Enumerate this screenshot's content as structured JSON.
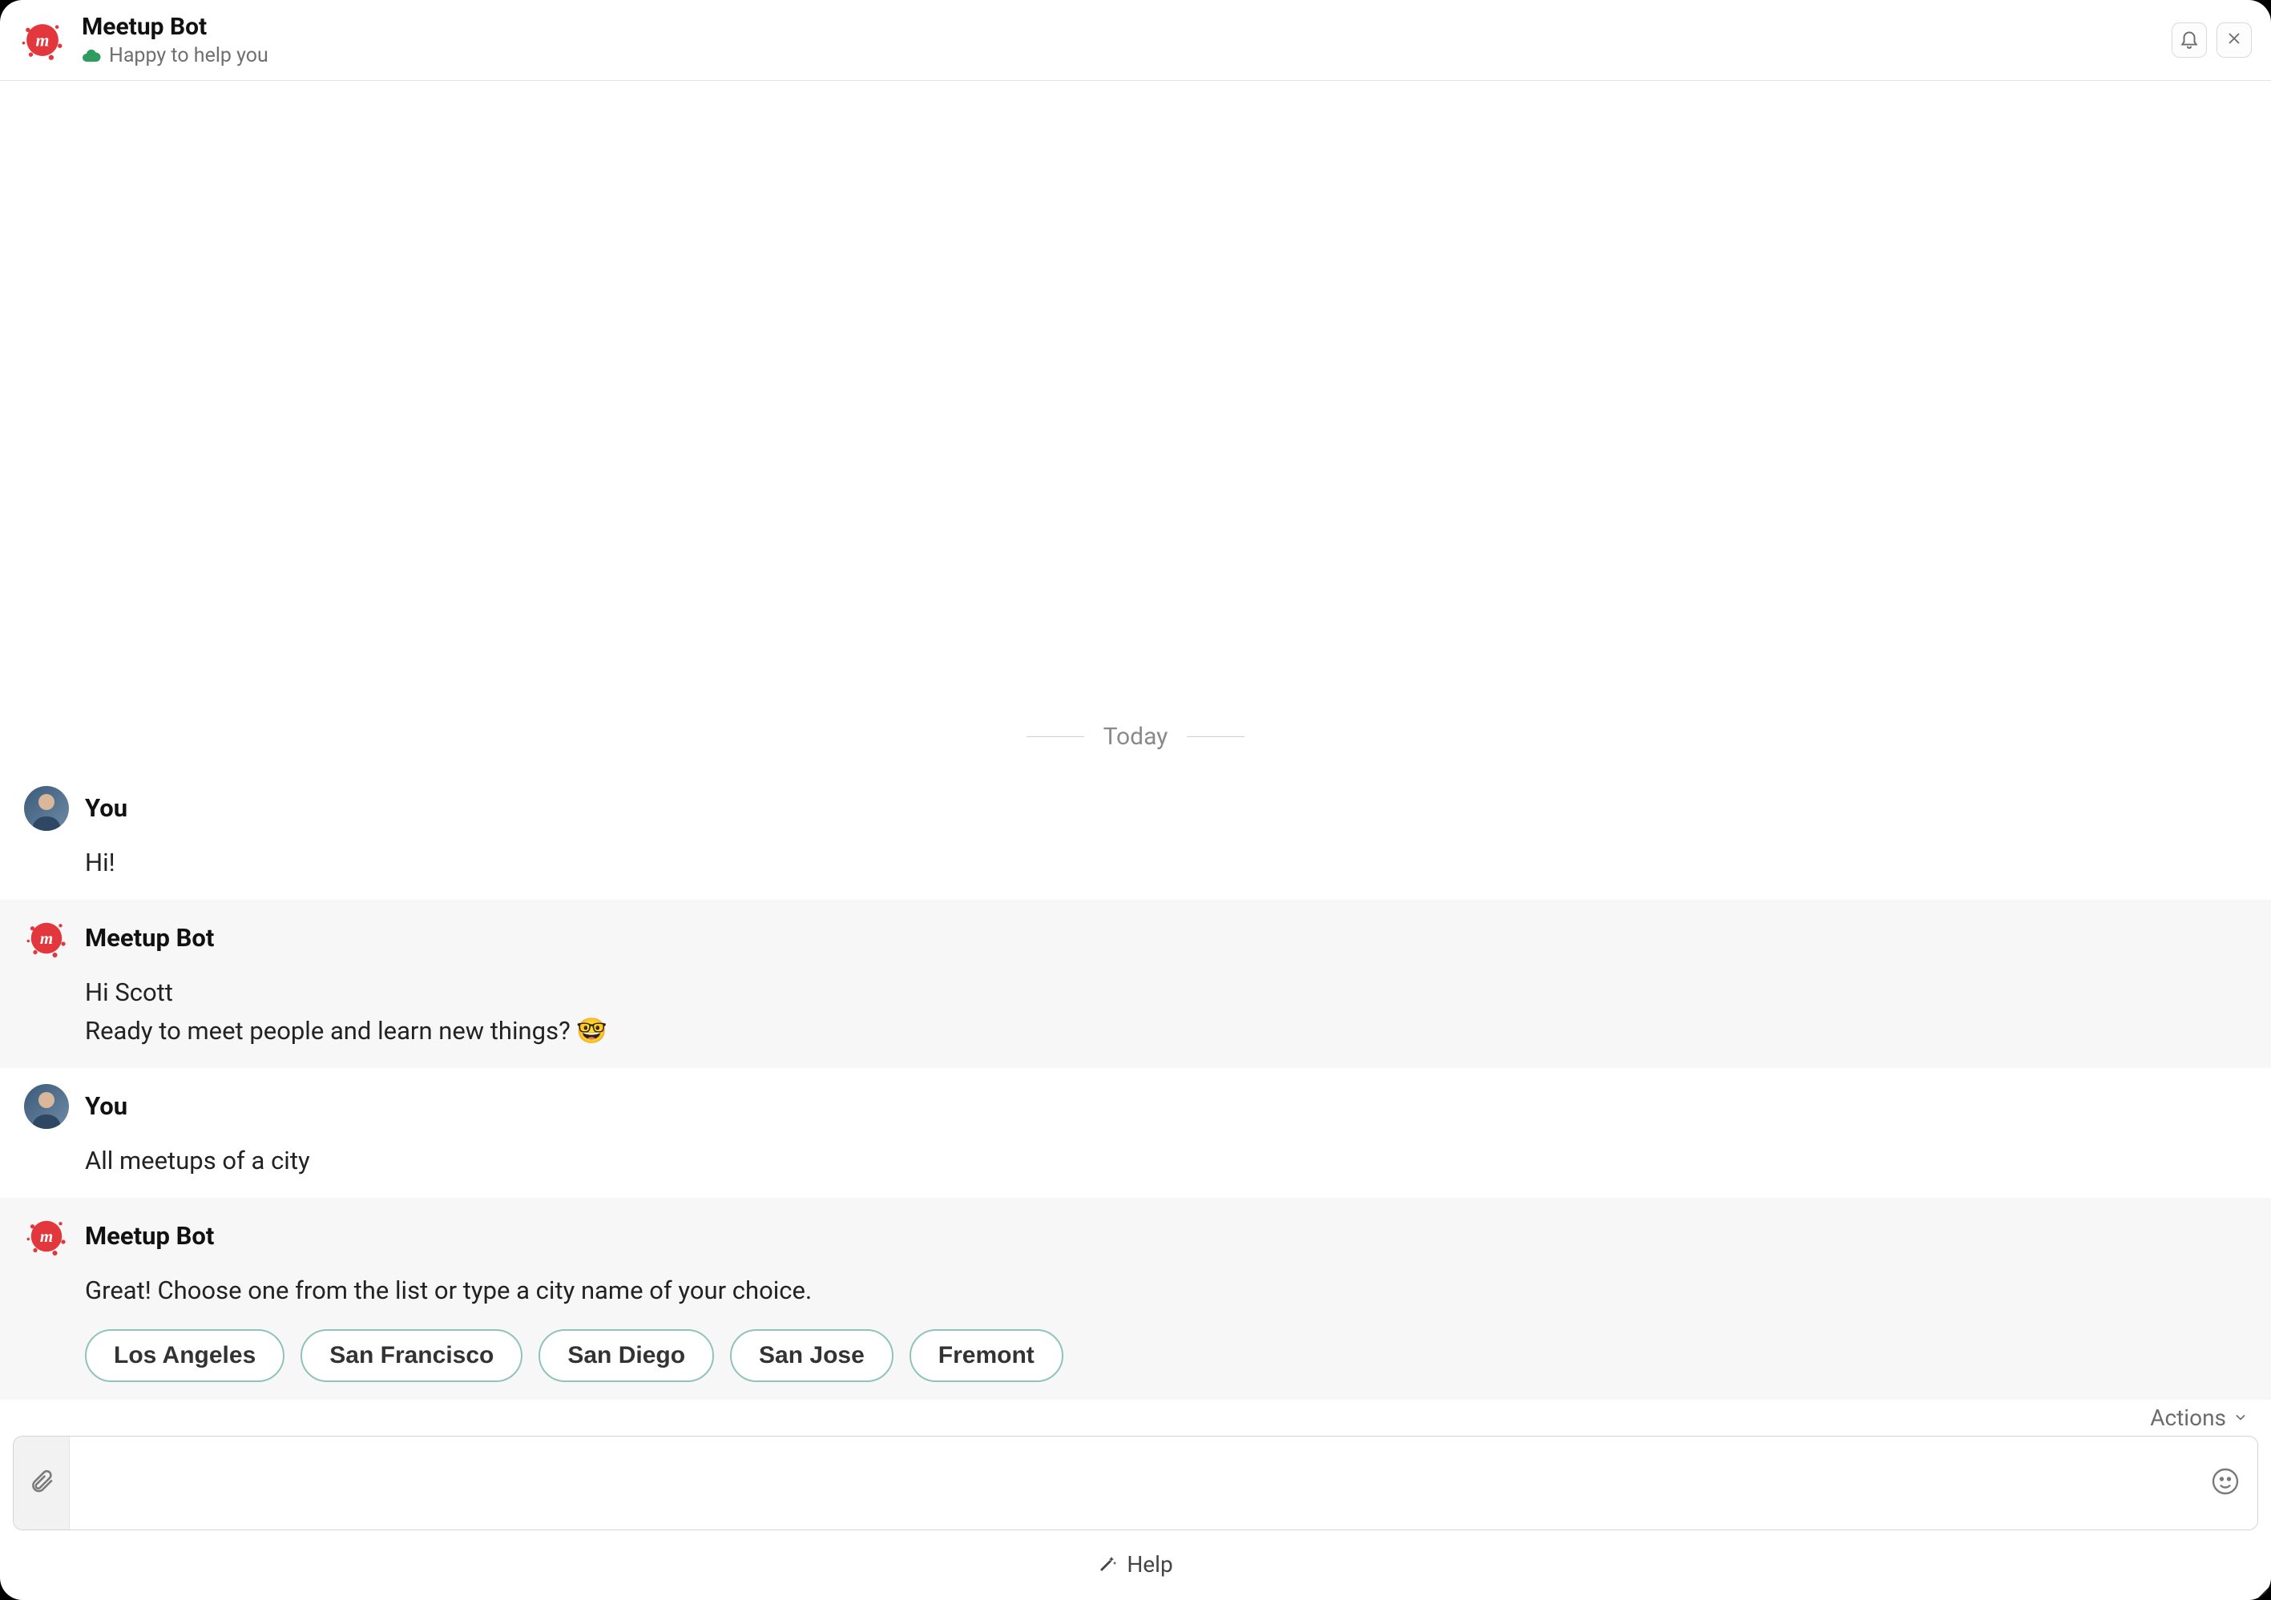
{
  "header": {
    "title": "Meetup Bot",
    "status": "Happy to help you"
  },
  "divider": {
    "label": "Today"
  },
  "senders": {
    "you": "You",
    "bot": "Meetup Bot"
  },
  "messages": {
    "m1": {
      "sender": "you",
      "text": "Hi!"
    },
    "m2": {
      "sender": "bot",
      "line1": "Hi Scott",
      "line2": "Ready to meet people and learn new things? 🤓"
    },
    "m3": {
      "sender": "you",
      "text": "All meetups of a city"
    },
    "m4": {
      "sender": "bot",
      "text": "Great! Choose one from the list or type a city name of your choice."
    }
  },
  "chips": [
    "Los Angeles",
    "San Francisco",
    "San Diego",
    "San Jose",
    "Fremont"
  ],
  "footer": {
    "actions": "Actions",
    "help": "Help"
  },
  "input": {
    "placeholder": ""
  },
  "icons": {
    "status": "cloud-online-icon",
    "bell": "bell-icon",
    "close": "close-icon",
    "attach": "paperclip-icon",
    "emoji": "smiley-icon",
    "help": "magic-wand-icon",
    "chevron": "chevron-down-icon"
  },
  "colors": {
    "brand": "#e2373c",
    "chip_border": "#8fc4b8",
    "status_green": "#2e9c5e"
  }
}
